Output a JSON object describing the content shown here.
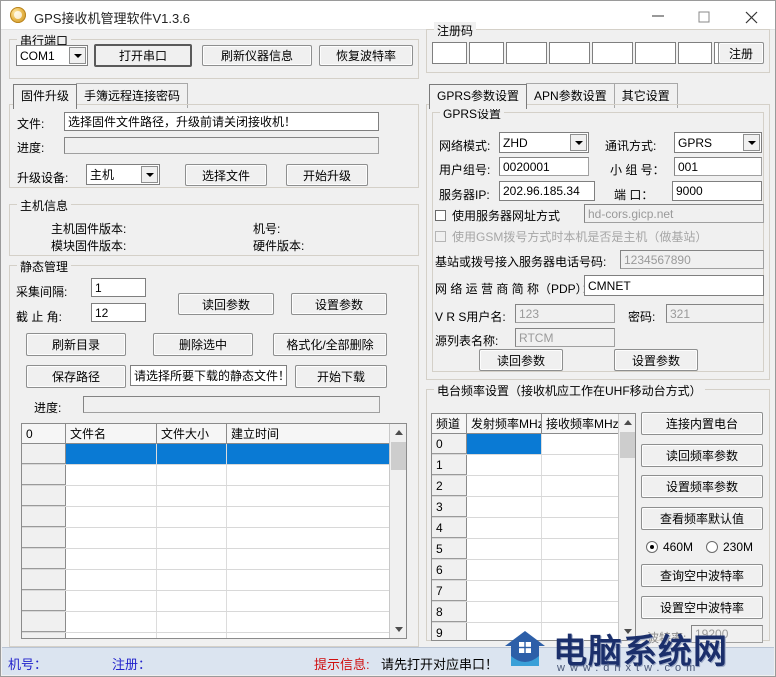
{
  "window": {
    "title": "GPS接收机管理软件V1.3.6",
    "icon": "app-icon",
    "minimize": "—",
    "maximize": "□",
    "close": "✕"
  },
  "serial_port": {
    "legend": "串行端口",
    "port_value": "COM1",
    "open_button": "打开串口",
    "refresh_button": "刷新仪器信息",
    "restore_baud_button": "恢复波特率"
  },
  "left_tabs": [
    {
      "label": "固件升级",
      "active": true
    },
    {
      "label": "手簿远程连接密码",
      "active": false
    }
  ],
  "firmware": {
    "file_label": "文件:",
    "file_value": "选择固件文件路径，升级前请关闭接收机！",
    "progress_label": "进度:",
    "progress_value": "",
    "device_label": "升级设备:",
    "device_value": "主机",
    "select_file_button": "选择文件",
    "start_upgrade_button": "开始升级"
  },
  "host_info": {
    "legend": "主机信息",
    "host_firmware_label": "主机固件版本:",
    "host_firmware_value": "",
    "module_firmware_label": "模块固件版本:",
    "module_firmware_value": "",
    "machine_no_label": "机号:",
    "machine_no_value": "",
    "hardware_label": "硬件版本:",
    "hardware_value": ""
  },
  "static_mgmt": {
    "legend": "静态管理",
    "interval_label": "采集间隔:",
    "interval_value": "1",
    "cutoff_label": "截 止 角:",
    "cutoff_value": "12",
    "read_params_button": "读回参数",
    "set_params_button": "设置参数",
    "refresh_dir_button": "刷新目录",
    "delete_selected_button": "删除选中",
    "format_all_button": "格式化/全部删除",
    "save_path_button": "保存路径",
    "path_value": "请选择所要下载的静态文件！",
    "start_download_button": "开始下载",
    "progress_label": "进度:",
    "progress_value": ""
  },
  "file_table": {
    "columns": [
      "0",
      "文件名",
      "文件大小",
      "建立时间"
    ],
    "rows": [
      {
        "index": "",
        "name": "",
        "size": "",
        "time": "",
        "selected": true
      },
      {
        "index": "",
        "name": "",
        "size": "",
        "time": "",
        "selected": false
      },
      {
        "index": "",
        "name": "",
        "size": "",
        "time": "",
        "selected": false
      },
      {
        "index": "",
        "name": "",
        "size": "",
        "time": "",
        "selected": false
      },
      {
        "index": "",
        "name": "",
        "size": "",
        "time": "",
        "selected": false
      },
      {
        "index": "",
        "name": "",
        "size": "",
        "time": "",
        "selected": false
      },
      {
        "index": "",
        "name": "",
        "size": "",
        "time": "",
        "selected": false
      },
      {
        "index": "",
        "name": "",
        "size": "",
        "time": "",
        "selected": false
      },
      {
        "index": "",
        "name": "",
        "size": "",
        "time": "",
        "selected": false
      },
      {
        "index": "",
        "name": "",
        "size": "",
        "time": "",
        "selected": false
      }
    ]
  },
  "register": {
    "legend": "注册码",
    "fields": [
      "",
      "",
      "",
      "",
      "",
      "",
      "",
      ""
    ],
    "register_button": "注册"
  },
  "right_tabs": [
    {
      "label": "GPRS参数设置",
      "active": true
    },
    {
      "label": "APN参数设置",
      "active": false
    },
    {
      "label": "其它设置",
      "active": false
    }
  ],
  "gprs": {
    "legend": "GPRS设置",
    "net_mode_label": "网络模式:",
    "net_mode_value": "ZHD",
    "comm_mode_label": "通讯方式:",
    "comm_mode_value": "GPRS",
    "user_group_label": "用户组号:",
    "user_group_value": "0020001",
    "sub_group_label": "小 组 号：",
    "sub_group_value": "001",
    "server_ip_label": "服务器IP:",
    "server_ip_value": "202.96.185.34",
    "port_label": "端  口：",
    "port_value": "9000",
    "use_url_checkbox": "使用服务器网址方式",
    "use_url_checked": false,
    "url_value": "hd-cors.gicp.net",
    "gsm_master_checkbox": "使用GSM拨号方式时本机是否是主机（做基站）",
    "gsm_master_checked": false,
    "gsm_master_disabled": true,
    "dial_phone_label": "基站或拨号接入服务器电话号码:",
    "dial_phone_value": "1234567890",
    "pdp_label": "网 络 运 营 商 简 称（PDP）：",
    "pdp_value": "CMNET",
    "vrs_user_label": "V R S用户名:",
    "vrs_user_value": "123",
    "vrs_pwd_label": "密码:",
    "vrs_pwd_value": "321",
    "mount_label": "源列表名称:",
    "mount_value": "RTCM",
    "read_params_button": "读回参数",
    "set_params_button": "设置参数"
  },
  "radio": {
    "legend": "电台频率设置（接收机应工作在UHF移动台方式）",
    "columns": [
      "频道",
      "发射频率MHz",
      "接收频率MHz"
    ],
    "rows": [
      {
        "ch": "0",
        "tx": "",
        "rx": "",
        "selected": true
      },
      {
        "ch": "1",
        "tx": "",
        "rx": "",
        "selected": false
      },
      {
        "ch": "2",
        "tx": "",
        "rx": "",
        "selected": false
      },
      {
        "ch": "3",
        "tx": "",
        "rx": "",
        "selected": false
      },
      {
        "ch": "4",
        "tx": "",
        "rx": "",
        "selected": false
      },
      {
        "ch": "5",
        "tx": "",
        "rx": "",
        "selected": false
      },
      {
        "ch": "6",
        "tx": "",
        "rx": "",
        "selected": false
      },
      {
        "ch": "7",
        "tx": "",
        "rx": "",
        "selected": false
      },
      {
        "ch": "8",
        "tx": "",
        "rx": "",
        "selected": false
      },
      {
        "ch": "9",
        "tx": "",
        "rx": "",
        "selected": false
      }
    ],
    "connect_button": "连接内置电台",
    "read_freq_button": "读回频率参数",
    "set_freq_button": "设置频率参数",
    "view_default_button": "查看频率默认值",
    "band_460": "460M",
    "band_230": "230M",
    "band_selected": "460M",
    "query_air_baud_button": "查询空中波特率",
    "set_air_baud_button": "设置空中波特率",
    "baud_label": "波特率:",
    "baud_value": "19200"
  },
  "statusbar": {
    "machine_label": "机号：",
    "register_label": "注册：",
    "hint_prefix": "提示信息:",
    "hint_text": "请先打开对应串口！"
  },
  "watermark": {
    "title": "电脑系统网",
    "url": "www.dnxtw.com"
  }
}
